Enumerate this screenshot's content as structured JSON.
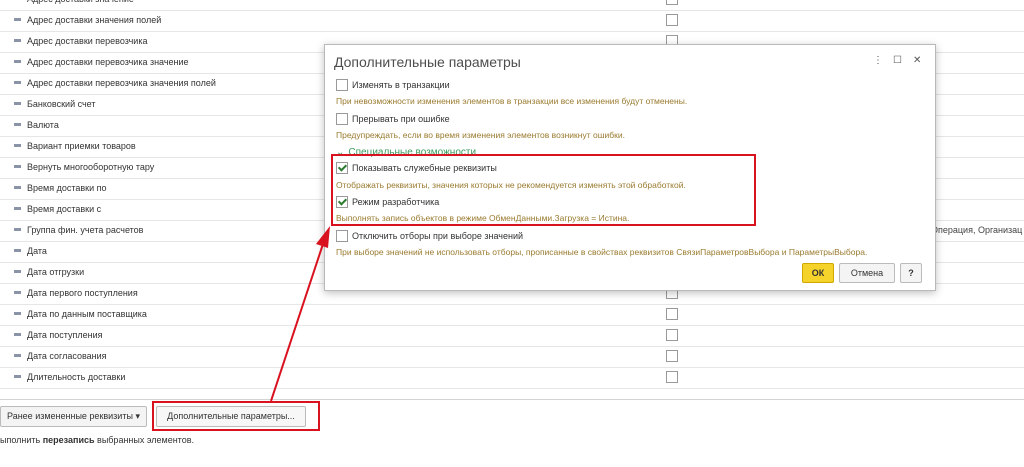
{
  "table": {
    "rows": [
      {
        "name": "Адрес доставки значение"
      },
      {
        "name": "Адрес доставки значения полей"
      },
      {
        "name": "Адрес доставки перевозчика"
      },
      {
        "name": "Адрес доставки перевозчика значение"
      },
      {
        "name": "Адрес доставки перевозчика значения полей"
      },
      {
        "name": "Банковский счет"
      },
      {
        "name": "Валюта"
      },
      {
        "name": "Вариант приемки товаров"
      },
      {
        "name": "Вернуть многооборотную тару"
      },
      {
        "name": "Время доставки по"
      },
      {
        "name": "Время доставки с"
      },
      {
        "name": "Группа фин. учета расчетов",
        "extra": "Операция, Организац"
      },
      {
        "name": "Дата"
      },
      {
        "name": "Дата отгрузки"
      },
      {
        "name": "Дата первого поступления"
      },
      {
        "name": "Дата по данным поставщика"
      },
      {
        "name": "Дата поступления"
      },
      {
        "name": "Дата согласования"
      },
      {
        "name": "Длительность доставки"
      }
    ]
  },
  "footer": {
    "prev_button": "Ранее измененные реквизиты",
    "prev_arrow": "▾",
    "add_button": "Дополнительные параметры...",
    "status_prefix": "ыполнить ",
    "status_bold": "перезапись",
    "status_suffix": " выбранных элементов."
  },
  "dialog": {
    "title": "Дополнительные параметры",
    "icons": {
      "menu": "⋮",
      "maximize": "☐",
      "close": "✕"
    },
    "change_in_transaction": {
      "label": "Изменять в транзакции",
      "checked": false,
      "hint": "При невозможности изменения элементов в транзакции все изменения будут отменены."
    },
    "stop_on_error": {
      "label": "Прерывать при ошибке",
      "checked": false,
      "hint": "Предупреждать, если во время изменения элементов возникнут ошибки."
    },
    "section_title": "Специальные возможности",
    "show_service": {
      "label": "Показывать служебные реквизиты",
      "checked": true,
      "hint": "Отображать реквизиты, значения которых не рекомендуется изменять этой обработкой."
    },
    "dev_mode": {
      "label": "Режим разработчика",
      "checked": true,
      "hint": "Выполнять запись объектов в режиме ОбменДанными.Загрузка = Истина."
    },
    "disable_filters": {
      "label": "Отключить отборы при выборе значений",
      "checked": false,
      "hint": "При выборе значений не использовать отборы, прописанные в свойствах реквизитов СвязиПараметровВыбора и ПараметрыВыбора."
    },
    "ok": "ОК",
    "cancel": "Отмена",
    "help": "?"
  },
  "colors": {
    "highlight": "#d9121f",
    "ok_button": "#f6d32b",
    "section": "#3a9a5a",
    "hint": "#9a7b2f"
  }
}
